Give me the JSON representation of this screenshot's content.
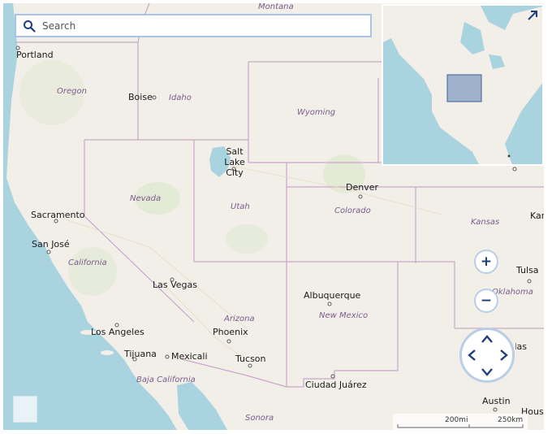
{
  "search": {
    "placeholder": "Search"
  },
  "states": [
    "Montana",
    "Oregon",
    "Idaho",
    "Wyoming",
    "Nevada",
    "Utah",
    "Colorado",
    "Kansas",
    "California",
    "Arizona",
    "New Mexico",
    "Oklahoma",
    "Baja California",
    "Sonora"
  ],
  "cities": [
    "Portland",
    "Boise",
    "Salt Lake City",
    "Denver",
    "Sacramento",
    "San José",
    "Las Vegas",
    "Albuquerque",
    "Los Angeles",
    "Phoenix",
    "Tijuana",
    "Mexicali",
    "Tucson",
    "Ciudad Juárez",
    "Tulsa",
    "Austin",
    "Kansas City",
    "Dallas",
    "Houston"
  ],
  "controls": {
    "zoom_in": "+",
    "zoom_out": "−"
  },
  "scale": {
    "imperial": "200mi",
    "metric": "250km"
  },
  "colors": {
    "land": "#f2efe9",
    "water": "#a9d3df",
    "border": "#c9a6cc",
    "control_ring": "#b9cfe6",
    "control_icon": "#1f3f7a",
    "search_border": "#a8c4e6"
  },
  "icons": [
    "search-icon",
    "expand-icon",
    "chevron-up-icon",
    "chevron-down-icon",
    "chevron-left-icon",
    "chevron-right-icon"
  ]
}
